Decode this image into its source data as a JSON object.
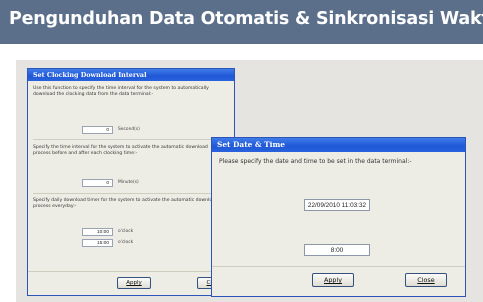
{
  "banner": {
    "title": "Pengunduhan Data Otomatis & Sinkronisasi Waktu"
  },
  "interval_dialog": {
    "title": "Set Clocking Download Interval",
    "desc1": "Use this function to specify the time interval for the system to automatically download the clocking data from the data terminal:-",
    "seconds_value": "0",
    "seconds_unit": "Second(s)",
    "desc2": "Specify the time interval for the system to activate the automatic download process before and after each clocking time:-",
    "minutes_value": "0",
    "minutes_unit": "Minute(s)",
    "desc3": "Specify daily download timer for the system to activate the automatic download process everyday:-",
    "timer1_value": "10:00",
    "timer1_unit": "o'clock",
    "timer2_value": "15:00",
    "timer2_unit": "o'clock",
    "apply_label": "Apply",
    "close_label": "Close"
  },
  "datetime_dialog": {
    "title": "Set Date & Time",
    "desc": "Please specify the date and time to be set in the data terminal:-",
    "datetime_value": "22/09/2010 11:03:32",
    "time_value": "8:00",
    "apply_label": "Apply",
    "close_label": "Close"
  }
}
